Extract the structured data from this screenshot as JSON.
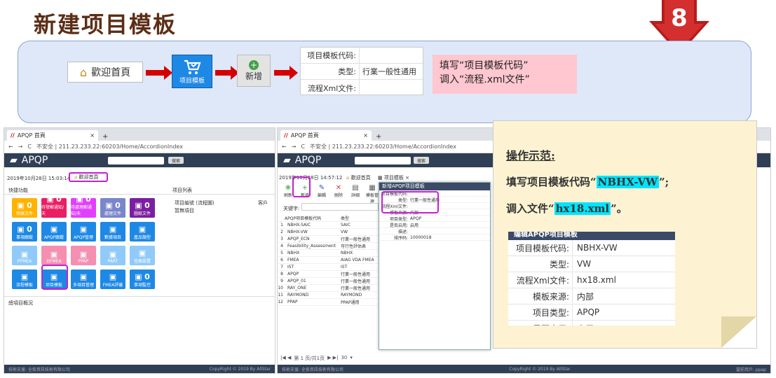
{
  "title": "新建项目模板",
  "step_badge": "8",
  "banner": {
    "home_label": "歡迎首頁",
    "tile_label": "项目模板",
    "add_label": "新增",
    "form": [
      {
        "label": "项目模板代码:",
        "value": ""
      },
      {
        "label": "类型:",
        "value": "行業一般性通用"
      },
      {
        "label": "流程Xml文件:",
        "value": ""
      }
    ],
    "note_line1": "填写“项目模板代码”",
    "note_line2": "调入“流程.xml文件”"
  },
  "left_window": {
    "tab_title": "APQP 首頁",
    "address": "不安全 | 211.23.233.22:60203/Home/AccordionIndex",
    "app_name": "APQP",
    "search_btn": "搜索",
    "datetime": "2019年10月28日 15:03:14",
    "home_tab": "歡迎首頁",
    "panel_quick": "快捷功能",
    "panel_projects": "项目列表",
    "panel_overview": "總項目概況",
    "col1": "项目編號 (流程圖)",
    "col2": "客戶",
    "row1": "暂無項目",
    "tiles": [
      {
        "label": "待展文件",
        "count": "0",
        "color": "#ffb300"
      },
      {
        "label": "待發郵通知/天",
        "count": "0",
        "color": "#e91e63"
      },
      {
        "label": "待處理郵通知/天",
        "count": "0",
        "color": "#e040fb"
      },
      {
        "label": "處理文件",
        "count": "0",
        "color": "#7986cb"
      },
      {
        "label": "圖紙文件",
        "count": "0",
        "color": "#7b1fa2"
      },
      {
        "label": "事項跟蹤",
        "count": "0",
        "color": "#1e88e5"
      },
      {
        "label": "APQP跟蹤",
        "count": "",
        "color": "#1e88e5"
      },
      {
        "label": "APQP管理",
        "count": "",
        "color": "#1e88e5"
      },
      {
        "label": "數據項目",
        "count": "",
        "color": "#1e88e5"
      },
      {
        "label": "產品類型",
        "count": "",
        "color": "#1e88e5"
      },
      {
        "label": "PFMEA",
        "count": "",
        "color": "#90caf9"
      },
      {
        "label": "DFMEA",
        "count": "",
        "color": "#f48fb1"
      },
      {
        "label": "PPAP",
        "count": "",
        "color": "#f48fb1"
      },
      {
        "label": "PART",
        "count": "",
        "color": "#90caf9"
      },
      {
        "label": "任務設置",
        "count": "",
        "color": "#90caf9"
      },
      {
        "label": "流程模板",
        "count": "",
        "color": "#1e88e5"
      },
      {
        "label": "项目模板",
        "count": "",
        "color": "#1e88e5"
      },
      {
        "label": "多項目管理",
        "count": "",
        "color": "#1e88e5"
      },
      {
        "label": "FMEA評審",
        "count": "",
        "color": "#1e88e5"
      },
      {
        "label": "事項監控",
        "count": "0",
        "color": "#1e88e5"
      }
    ],
    "status_left": "技術支援: 全俊資訊技術有限公司",
    "status_right": "CopyRight © 2019 By AllStar"
  },
  "right_window": {
    "tab_title": "APQP 首頁",
    "address": "不安全 | 211.23.233.22:60203/Home/AccordionIndex",
    "app_name": "APQP",
    "search_btn": "搜索",
    "datetime": "2019年10月28日 14:57:12",
    "home_tab": "歡迎首頁",
    "module_tab": "项目模板",
    "toolbar": [
      "刷新",
      "新增",
      "編輯",
      "刪除",
      "詳細",
      "模板管理"
    ],
    "keyword_label": "关键字:",
    "grid_head": [
      "",
      "APQP项目模板代码",
      "类型"
    ],
    "rows": [
      [
        "1",
        "NBHX-SAIC",
        "SAIC"
      ],
      [
        "2",
        "NBHX-VW",
        "VW"
      ],
      [
        "3",
        "APQP_ECN",
        "行業一般性通用"
      ],
      [
        "4",
        "Feasibility_Assessment",
        "可行性評估表"
      ],
      [
        "5",
        "NBHX",
        "NBHX"
      ],
      [
        "6",
        "FMEA",
        "AIAG VDA FMEA"
      ],
      [
        "7",
        "IST",
        "IST"
      ],
      [
        "8",
        "APQP",
        "行業一般性通用"
      ],
      [
        "9",
        "APQP_01",
        "行業一般性通用"
      ],
      [
        "10",
        "RAY_ONE",
        "行業一般性通用"
      ],
      [
        "11",
        "RAYMOND",
        "RAYMOND"
      ],
      [
        "12",
        "PPAP",
        "PPAP通用"
      ]
    ],
    "dialog_title": "新增APQP项目模板",
    "dialog_rows": [
      {
        "label": "项目模板代码:",
        "value": ""
      },
      {
        "label": "类型:",
        "value": "行業一般性通用"
      },
      {
        "label": "流程Xml文件:",
        "value": ""
      },
      {
        "label": "模板来源:",
        "value": "内部"
      },
      {
        "label": "项目类型:",
        "value": "APQP"
      },
      {
        "label": "是否启用:",
        "value": "启用"
      },
      {
        "label": "描述:",
        "value": ""
      },
      {
        "label": "排序码:",
        "value": "10000018"
      }
    ],
    "pager": "第 1 页/共1页",
    "page_size": "30",
    "status_left": "技術支援: 全俊資訊技術有限公司",
    "status_mid": "CopyRight © 2019 By AllStar",
    "status_right": "當前用戶: ppap"
  },
  "note": {
    "heading": "操作示范:",
    "line1_pre": "填写项目模板代码“",
    "line1_hl": "NBHX-VW",
    "line1_post": "”;",
    "line2_pre": "调入文件“",
    "line2_hl": "hx18.xml",
    "line2_post": "”。",
    "snap_title": "编辑APQP项目模板",
    "snap_rows": [
      {
        "label": "项目模板代码:",
        "value": "NBHX-VW"
      },
      {
        "label": "类型:",
        "value": "VW"
      },
      {
        "label": "流程Xml文件:",
        "value": "hx18.xml"
      },
      {
        "label": "模板来源:",
        "value": "内部"
      },
      {
        "label": "项目类型:",
        "value": "APQP"
      },
      {
        "label": "是否启用:",
        "value": "启用"
      }
    ]
  }
}
